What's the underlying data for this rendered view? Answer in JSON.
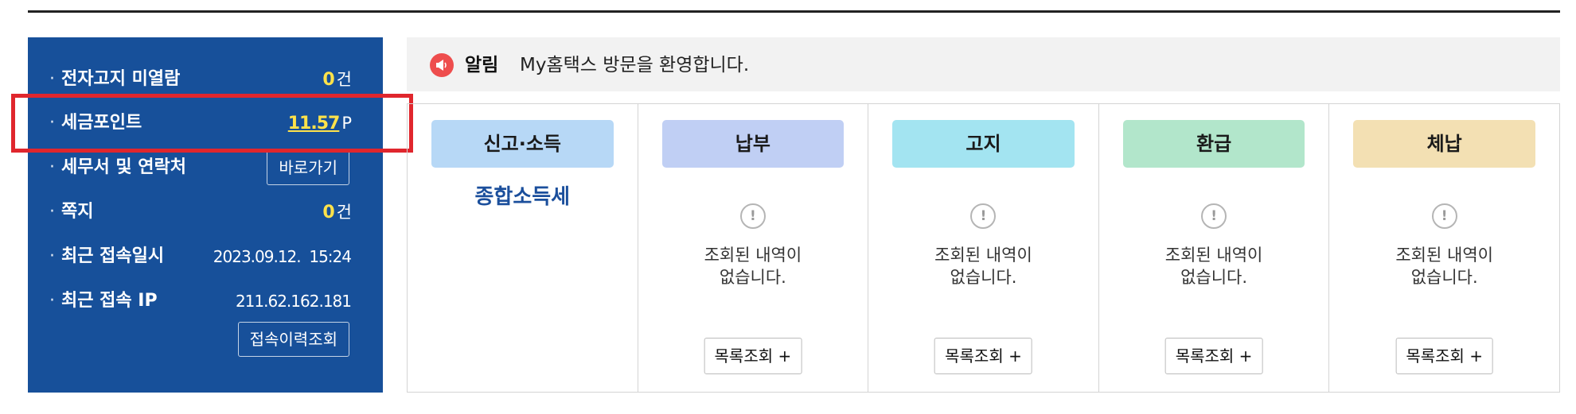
{
  "info_panel": {
    "unread_notice": {
      "label": "전자고지 미열람",
      "count": "0",
      "unit": "건"
    },
    "tax_point": {
      "label": "세금포인트",
      "value": "11.57",
      "unit": "P"
    },
    "tax_office": {
      "label": "세무서 및 연락처",
      "button": "바로가기"
    },
    "messages": {
      "label": "쪽지",
      "count": "0",
      "unit": "건"
    },
    "last_login_time": {
      "label": "최근 접속일시",
      "value": "2023.09.12.  15:24"
    },
    "last_login_ip": {
      "label": "최근 접속 IP",
      "value": "211.62.162.181"
    },
    "history_button": "접속이력조회"
  },
  "notice": {
    "title": "알림",
    "text": "My홈택스 방문을 환영합니다."
  },
  "cards": [
    {
      "title": "신고·소득",
      "color": "#b7d8f6",
      "link": "종합소득세"
    },
    {
      "title": "납부",
      "color": "#c0cff4",
      "empty_line1": "조회된 내역이",
      "empty_line2": "없습니다.",
      "button": "목록조회 +"
    },
    {
      "title": "고지",
      "color": "#a3e4f1",
      "empty_line1": "조회된 내역이",
      "empty_line2": "없습니다.",
      "button": "목록조회 +"
    },
    {
      "title": "환급",
      "color": "#b2e6cb",
      "empty_line1": "조회된 내역이",
      "empty_line2": "없습니다.",
      "button": "목록조회 +"
    },
    {
      "title": "체납",
      "color": "#f3e0b3",
      "empty_line1": "조회된 내역이",
      "empty_line2": "없습니다.",
      "button": "목록조회 +"
    }
  ],
  "colors": {
    "panel_bg": "#17509a",
    "highlight": "#e0262d",
    "count_accent": "#ffe24a",
    "link": "#1b4f9c"
  }
}
